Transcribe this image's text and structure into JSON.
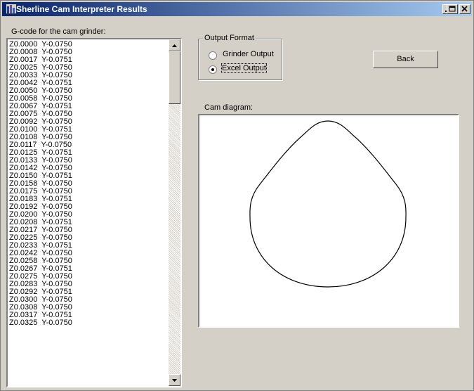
{
  "window": {
    "title": "Sherline Cam Interpreter Results",
    "controls": {
      "minimize": "minimize",
      "maximize": "maximize",
      "close": "close"
    }
  },
  "gcode": {
    "label": "G-code for the cam grinder:",
    "lines": [
      "Z0.0000  Y-0.0750",
      "Z0.0008  Y-0.0750",
      "Z0.0017  Y-0.0751",
      "Z0.0025  Y-0.0750",
      "Z0.0033  Y-0.0750",
      "Z0.0042  Y-0.0751",
      "Z0.0050  Y-0.0750",
      "Z0.0058  Y-0.0750",
      "Z0.0067  Y-0.0751",
      "Z0.0075  Y-0.0750",
      "Z0.0092  Y-0.0750",
      "Z0.0100  Y-0.0751",
      "Z0.0108  Y-0.0750",
      "Z0.0117  Y-0.0750",
      "Z0.0125  Y-0.0751",
      "Z0.0133  Y-0.0750",
      "Z0.0142  Y-0.0750",
      "Z0.0150  Y-0.0751",
      "Z0.0158  Y-0.0750",
      "Z0.0175  Y-0.0750",
      "Z0.0183  Y-0.0751",
      "Z0.0192  Y-0.0750",
      "Z0.0200  Y-0.0750",
      "Z0.0208  Y-0.0751",
      "Z0.0217  Y-0.0750",
      "Z0.0225  Y-0.0750",
      "Z0.0233  Y-0.0751",
      "Z0.0242  Y-0.0750",
      "Z0.0258  Y-0.0750",
      "Z0.0267  Y-0.0751",
      "Z0.0275  Y-0.0750",
      "Z0.0283  Y-0.0750",
      "Z0.0292  Y-0.0751",
      "Z0.0300  Y-0.0750",
      "Z0.0308  Y-0.0750",
      "Z0.0317  Y-0.0751",
      "Z0.0325  Y-0.0750"
    ]
  },
  "output_format": {
    "label": "Output Format",
    "options": [
      "Grinder Output",
      "Excel Output"
    ],
    "selected": "Excel Output"
  },
  "back_button": "Back",
  "diagram": {
    "label": "Cam diagram:",
    "icon": "cam-profile-outline"
  }
}
